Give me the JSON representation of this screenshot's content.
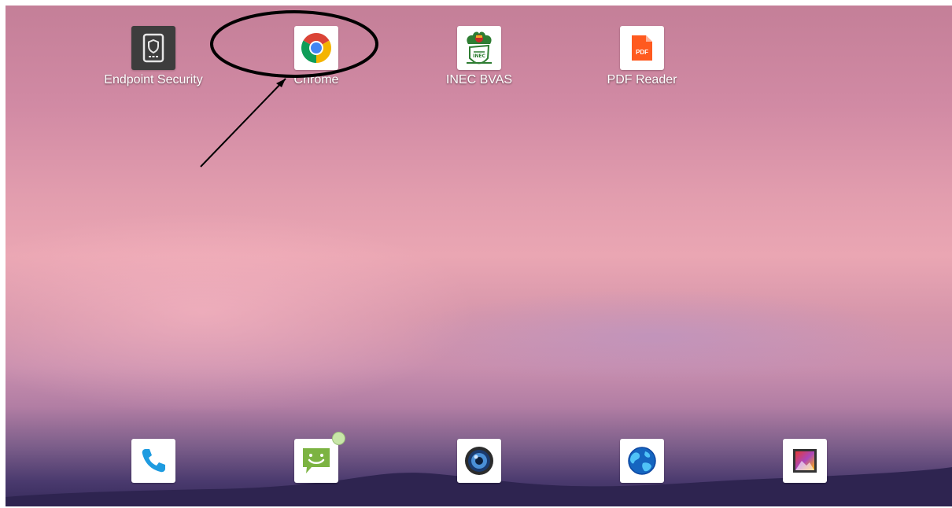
{
  "home_apps": [
    {
      "label": "Endpoint Security",
      "icon": "shield-phone-icon"
    },
    {
      "label": "Chrome",
      "icon": "chrome-icon"
    },
    {
      "label": "INEC BVAS",
      "icon": "inec-logo-icon"
    },
    {
      "label": "PDF Reader",
      "icon": "pdf-icon",
      "icon_text": "PDF"
    }
  ],
  "dock": [
    {
      "icon": "phone-icon"
    },
    {
      "icon": "messaging-icon",
      "has_notification_badge": true
    },
    {
      "icon": "camera-icon"
    },
    {
      "icon": "browser-globe-icon"
    },
    {
      "icon": "gallery-icon"
    }
  ],
  "colors": {
    "pdf_orange": "#ff5a1f",
    "phone_blue": "#1e9be0",
    "messaging_green": "#7cb342",
    "annotation": "#000000"
  }
}
